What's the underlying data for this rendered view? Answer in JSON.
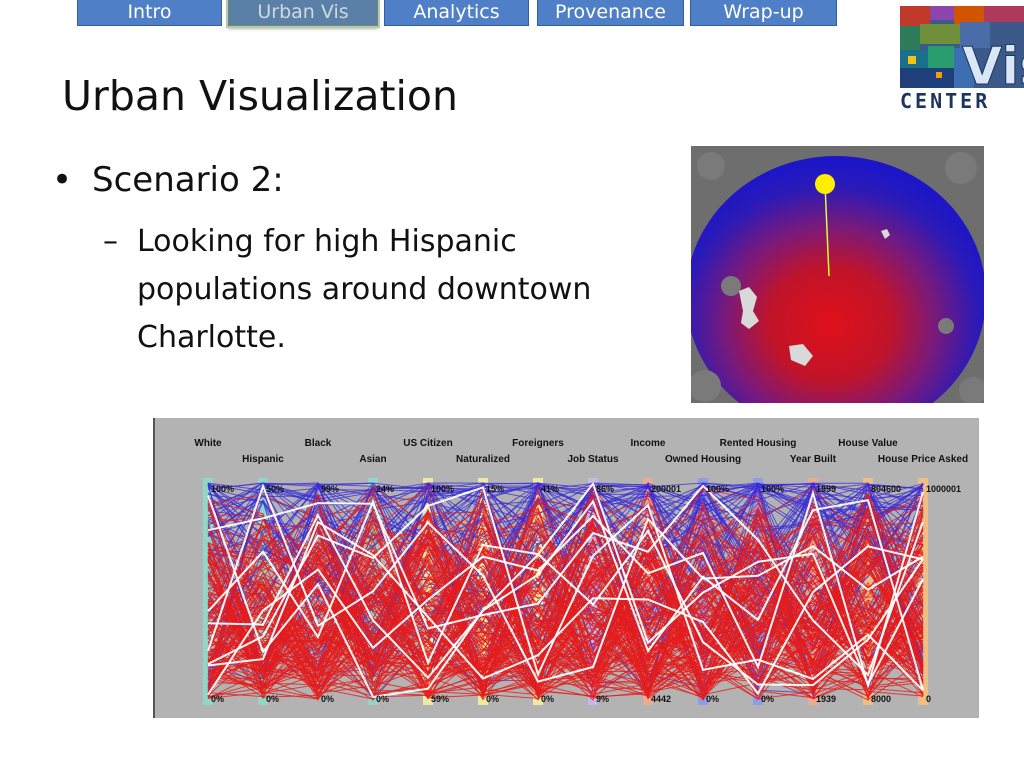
{
  "nav": {
    "tabs": [
      {
        "label": "Intro",
        "active": false
      },
      {
        "label": "Urban Vis",
        "active": true
      },
      {
        "label": "Analytics",
        "active": false
      },
      {
        "label": "Provenance",
        "active": false
      },
      {
        "label": "Wrap-up",
        "active": false
      }
    ]
  },
  "logo": {
    "text": "CENTER",
    "vis_text": "Vis"
  },
  "slide": {
    "title": "Urban Visualization",
    "bullet": "Scenario 2:",
    "sub_bullet": "Looking for high Hispanic populations around downtown Charlotte."
  },
  "colors": {
    "tab": "#4f7fc6",
    "tab_active": "#5b80a8",
    "plot_bg": "#b3b3b3",
    "line_red": "#e51b1b",
    "line_blue": "#3a2bd6",
    "line_white": "#ffffff"
  },
  "parallel_coords": {
    "axes": [
      {
        "name": "White",
        "top": "100%",
        "bottom": "0%",
        "band": "#8fd8c8"
      },
      {
        "name": "Hispanic",
        "top": "50%",
        "bottom": "0%",
        "band": "#8fd8c8"
      },
      {
        "name": "Black",
        "top": "99%",
        "bottom": "0%",
        "band": ""
      },
      {
        "name": "Asian",
        "top": "24%",
        "bottom": "0%",
        "band": "#8fd8c8"
      },
      {
        "name": "US Citizen",
        "top": "100%",
        "bottom": "59%",
        "band": "#f4f0a0"
      },
      {
        "name": "Naturalized",
        "top": "15%",
        "bottom": "0%",
        "band": "#f4f0a0"
      },
      {
        "name": "Foreigners",
        "top": "41%",
        "bottom": "0%",
        "band": "#f4f0a0"
      },
      {
        "name": "Job Status",
        "top": "86%",
        "bottom": "9%",
        "band": "#c8b8e8"
      },
      {
        "name": "Income",
        "top": "200001",
        "bottom": "4442",
        "band": "#f0a890"
      },
      {
        "name": "Owned Housing",
        "top": "100%",
        "bottom": "0%",
        "band": "#8c9ae8"
      },
      {
        "name": "Rented Housing",
        "top": "100%",
        "bottom": "0%",
        "band": "#8c9ae8"
      },
      {
        "name": "Year Built",
        "top": "1999",
        "bottom": "1939",
        "band": "#f0a890"
      },
      {
        "name": "House Value",
        "top": "804600",
        "bottom": "8000",
        "band": "#f4c080"
      },
      {
        "name": "House Price Asked",
        "top": "1000001",
        "bottom": "0",
        "band": "#f4c080"
      }
    ]
  }
}
